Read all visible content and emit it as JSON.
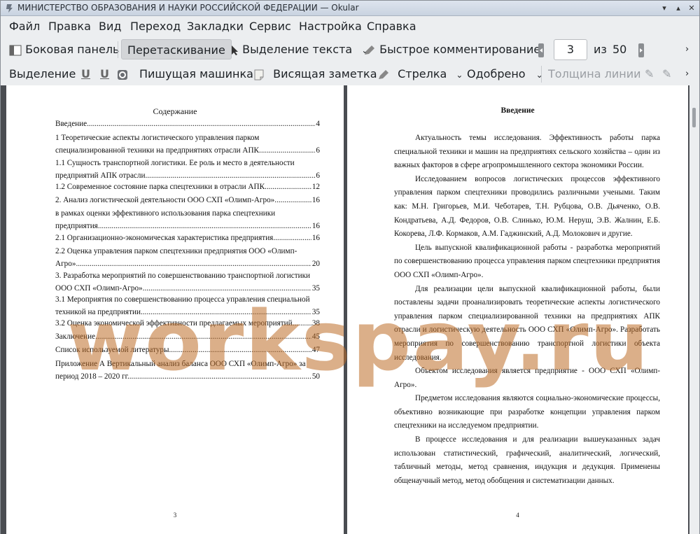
{
  "window": {
    "title": "МИНИСТЕРСТВО ОБРАЗОВАНИЯ И НАУКИ РОССИЙСКОЙ ФЕДЕРАЦИИ  — Okular"
  },
  "menu": [
    "Файл",
    "Правка",
    "Вид",
    "Переход",
    "Закладки",
    "Сервис",
    "Настройка",
    "Справка"
  ],
  "toolbar1": {
    "sidebar": "Боковая панель",
    "drag": "Перетаскивание",
    "text_select": "Выделение текста",
    "quick_annotate": "Быстрое комментирование",
    "page_current": "3",
    "page_of": "из",
    "page_total": "50"
  },
  "toolbar2": {
    "highlight": "Выделение",
    "typewriter": "Пишущая машинка",
    "hanging_note": "Висящая заметка",
    "arrow": "Стрелка",
    "approved": "Одобрено",
    "line_width": "Толщина линии"
  },
  "left_page": {
    "toc_title": "Содержание",
    "toc": [
      {
        "text": "Введение",
        "page": "4"
      },
      {
        "text": "1 Теоретические аспекты логистического управления парком",
        "text2": "специализированной техники на предприятиях отрасли АПК",
        "page": "6"
      },
      {
        "text": "1.1 Сущность транспортной логистики. Ее роль и место в деятельности",
        "text2": "предприятий АПК отрасли",
        "page": "6"
      },
      {
        "text": "1.2 Современное состояние парка спецтехники в отрасли АПК",
        "page": "12"
      },
      {
        "text": "2. Анализ логистической деятельности ООО СХП «Олимп-Агро»",
        "page": "16"
      },
      {
        "text": "в рамках оценки эффективного использования парка спецтехники",
        "text2": "предприятия",
        "page": "16"
      },
      {
        "text": "2.1 Организационно-экономическая характеристика предприятия",
        "page": "16"
      },
      {
        "text": "2.2 Оценка управления парком спецтехники предприятия ООО «Олимп-",
        "text2": "Агро»",
        "page": "20"
      },
      {
        "text": "3. Разработка мероприятий по совершенствованию транспортной логистики",
        "text2": "ООО СХП «Олимп-Агро»",
        "page": "35"
      },
      {
        "text": "3.1 Мероприятия по совершенствованию процесса управления специальной",
        "text2": "техникой на предприятии",
        "page": "35"
      },
      {
        "text": "3.2 Оценка экономической эффективности предлагаемых мероприятий",
        "page": "38"
      },
      {
        "text": "Заключение",
        "page": "45"
      },
      {
        "text": "Список используемой литературы",
        "page": "47"
      },
      {
        "text": "Приложение А Вертикальный анализ баланса ООО СХП «Олимп-Агро» за",
        "text2": "период 2018 – 2020 гг.",
        "page": "50"
      }
    ],
    "page_number": "3"
  },
  "right_page": {
    "title": "Введение",
    "paragraphs": [
      "Актуальность темы исследования. Эффективность работы парка специальной техники и машин на предприятиях сельского хозяйства – один из важных факторов в сфере агропромышленного сектора экономики России.",
      "Исследованием вопросов логистических процессов эффективного управления парком спецтехники проводились различными учеными. Таким как: М.Н. Григорьев, М.И. Чеботарев, Т.Н. Рубцова, О.В. Дьяченко, О.В. Кондратьева, А.Д. Федоров, О.В. Слинько, Ю.М. Неруш, Э.В. Жалнин, Е.Б. Кокорева, Л.Ф. Кормаков, А.М. Гаджинский, А.Д. Молокович и другие.",
      "Цель выпускной квалификационной работы - разработка мероприятий по совершенствованию процесса управления парком спецтехники предприятия ООО СХП «Олимп-Агро».",
      "Для реализации цели выпускной квалификационной работы, были поставлены задачи проанализировать теоретические аспекты логистического управления парком специализированной техники на предприятиях АПК отрасли и логистическую деятельность ООО СХП «Олимп-Агро». Разработать мероприятия по совершенствованию транспортной логистики объекта исследования.",
      "Объектом исследования является предприятие - ООО СХП «Олимп-Агро».",
      "Предметом исследования являются социально-экономические процессы, объективно возникающие при разработке концепции управления парком спецтехники на исследуемом предприятии.",
      "В процессе исследования и для реализации вышеуказанных задач использован статистический, графический, аналитический, логический, табличный методы, метод сравнения, индукция и дедукция. Применены общенаучный метод, метод обобщения и систематизации данных."
    ],
    "page_number": "4"
  },
  "watermark": "workspay.ru"
}
